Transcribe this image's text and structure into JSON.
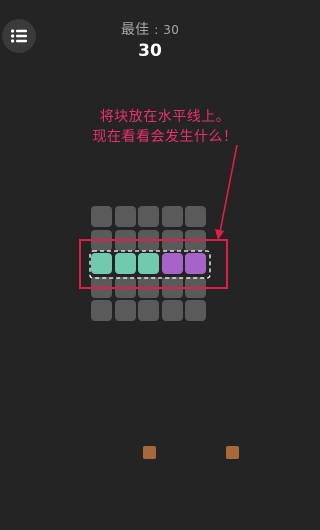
{
  "header": {
    "best_label": "最佳",
    "best_separator": ":",
    "best_value": "30",
    "score": "30"
  },
  "menu": {
    "icon": "list-menu-icon"
  },
  "tutorial": {
    "line1": "将块放在水平线上。",
    "line2": "现在看看会发生什么！"
  },
  "colors": {
    "background": "#242424",
    "empty_cell": "#5a5a5a",
    "teal": "#6fcaae",
    "purple": "#a863c9",
    "highlight_box": "#e01e4a",
    "hint_text": "#e8306c",
    "piece": "#a7693a"
  },
  "board": {
    "columns": 5,
    "rows": 5,
    "rows_state": [
      [
        "empty",
        "empty",
        "empty",
        "empty",
        "empty"
      ],
      [
        "empty",
        "empty",
        "empty",
        "empty",
        "empty"
      ],
      [
        "teal",
        "teal",
        "teal",
        "purple",
        "purple"
      ],
      [
        "empty",
        "empty",
        "empty",
        "empty",
        "empty"
      ],
      [
        "empty",
        "empty",
        "empty",
        "empty",
        "empty"
      ]
    ],
    "highlighted_row": 2
  },
  "tray": {
    "pieces": [
      "single-block",
      "single-block"
    ]
  }
}
